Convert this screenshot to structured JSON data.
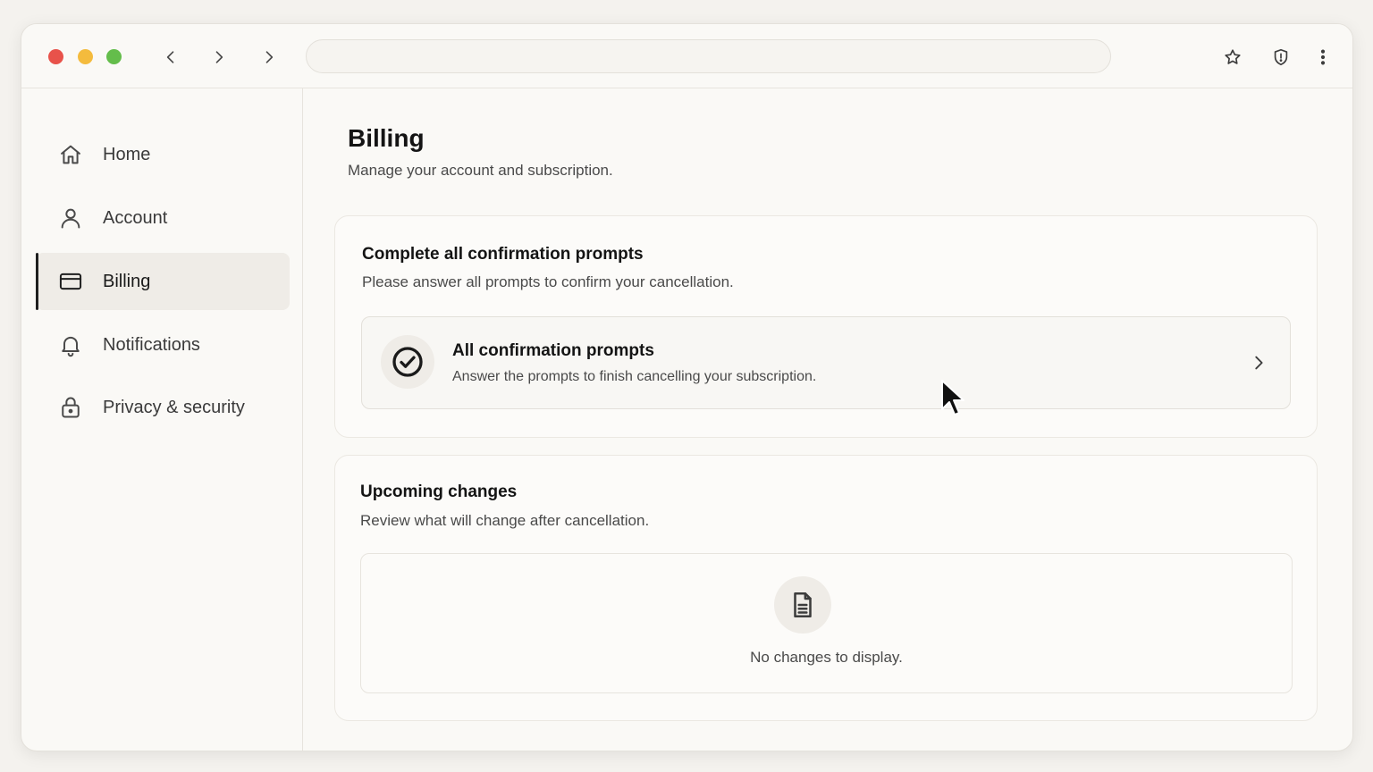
{
  "browser": {
    "back_icon": "chevron-left-icon",
    "forward_icon": "chevron-right-icon",
    "url": "",
    "bookmark_icon": "star-icon",
    "shield_icon": "shield-icon",
    "menu_icon": "kebab-menu-icon"
  },
  "sidebar": {
    "items": [
      {
        "label": "Home",
        "icon": "home-icon",
        "active": false
      },
      {
        "label": "Account",
        "icon": "user-icon",
        "active": false
      },
      {
        "label": "Billing",
        "icon": "credit-card-icon",
        "active": true
      },
      {
        "label": "Notifications",
        "icon": "bell-icon",
        "active": false
      },
      {
        "label": "Privacy & security",
        "icon": "lock-icon",
        "active": false
      }
    ]
  },
  "main": {
    "title": "Billing",
    "subtitle": "Manage your account and subscription.",
    "confirm_card": {
      "title": "Complete all confirmation prompts",
      "subtitle": "Please answer all prompts to confirm your cancellation.",
      "row": {
        "title": "All confirmation prompts",
        "subtitle": "Answer the prompts to finish cancelling your subscription.",
        "icon": "check-circle-icon"
      }
    },
    "changes_card": {
      "title": "Upcoming changes",
      "subtitle": "Review what will change after cancellation.",
      "empty_text": "No changes to display.",
      "empty_icon": "document-icon"
    }
  },
  "colors": {
    "background": "#f4f2ee",
    "window": "#faf9f6",
    "traffic_red": "#e8524a",
    "traffic_yellow": "#f4bb3d",
    "traffic_green": "#64bd4b",
    "active_item": "#efece7"
  }
}
